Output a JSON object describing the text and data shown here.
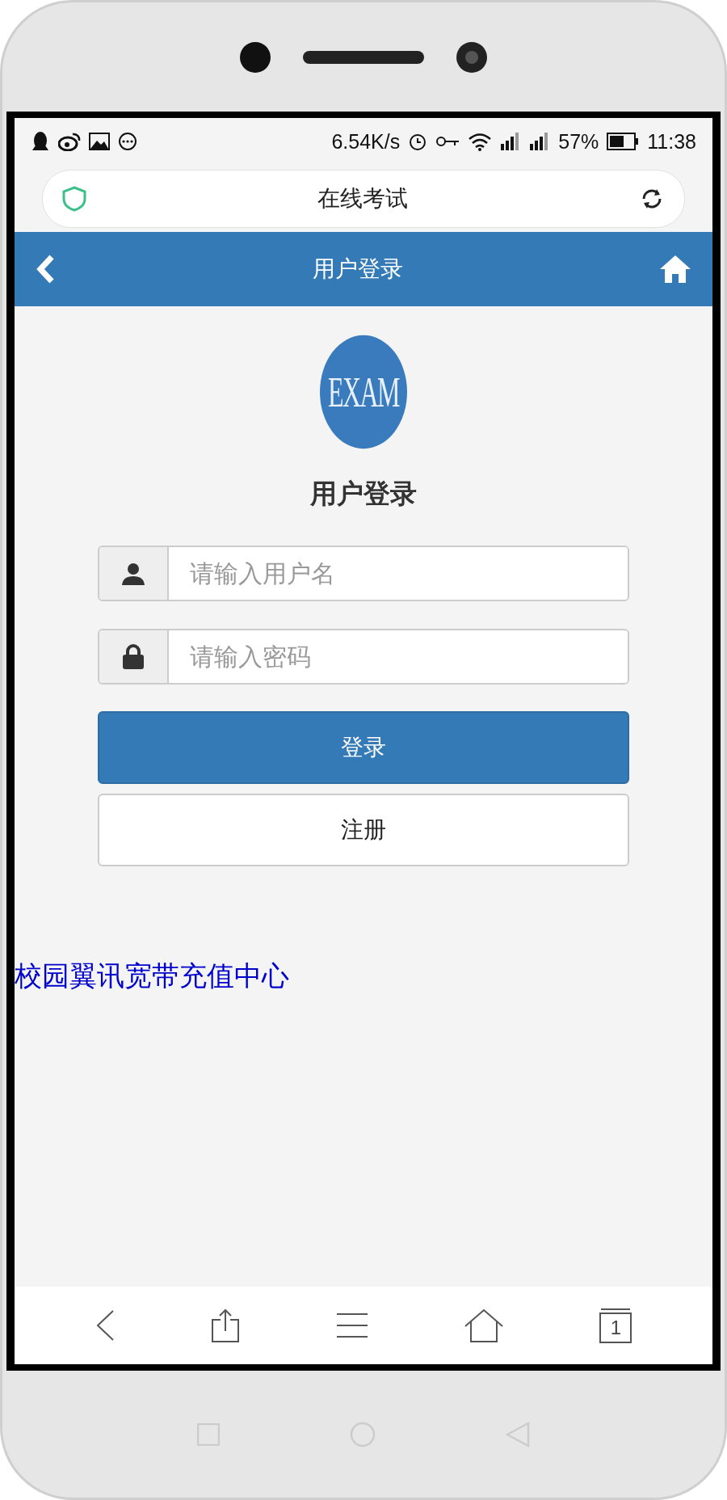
{
  "status_bar": {
    "speed": "6.54K/s",
    "battery": "57%",
    "time": "11:38"
  },
  "address_bar": {
    "title": "在线考试"
  },
  "header": {
    "title": "用户登录"
  },
  "logo": {
    "text": "EXAM"
  },
  "login": {
    "title": "用户登录",
    "fields": [
      {
        "kind": "user",
        "placeholder": "请输入用户名"
      },
      {
        "kind": "password",
        "placeholder": "请输入密码"
      }
    ],
    "buttons": [
      {
        "kind": "primary",
        "label": "登录"
      },
      {
        "kind": "default",
        "label": "注册"
      }
    ]
  },
  "link": "校园翼讯宽带充值中心",
  "toolbar": {
    "tab_count": "1"
  }
}
